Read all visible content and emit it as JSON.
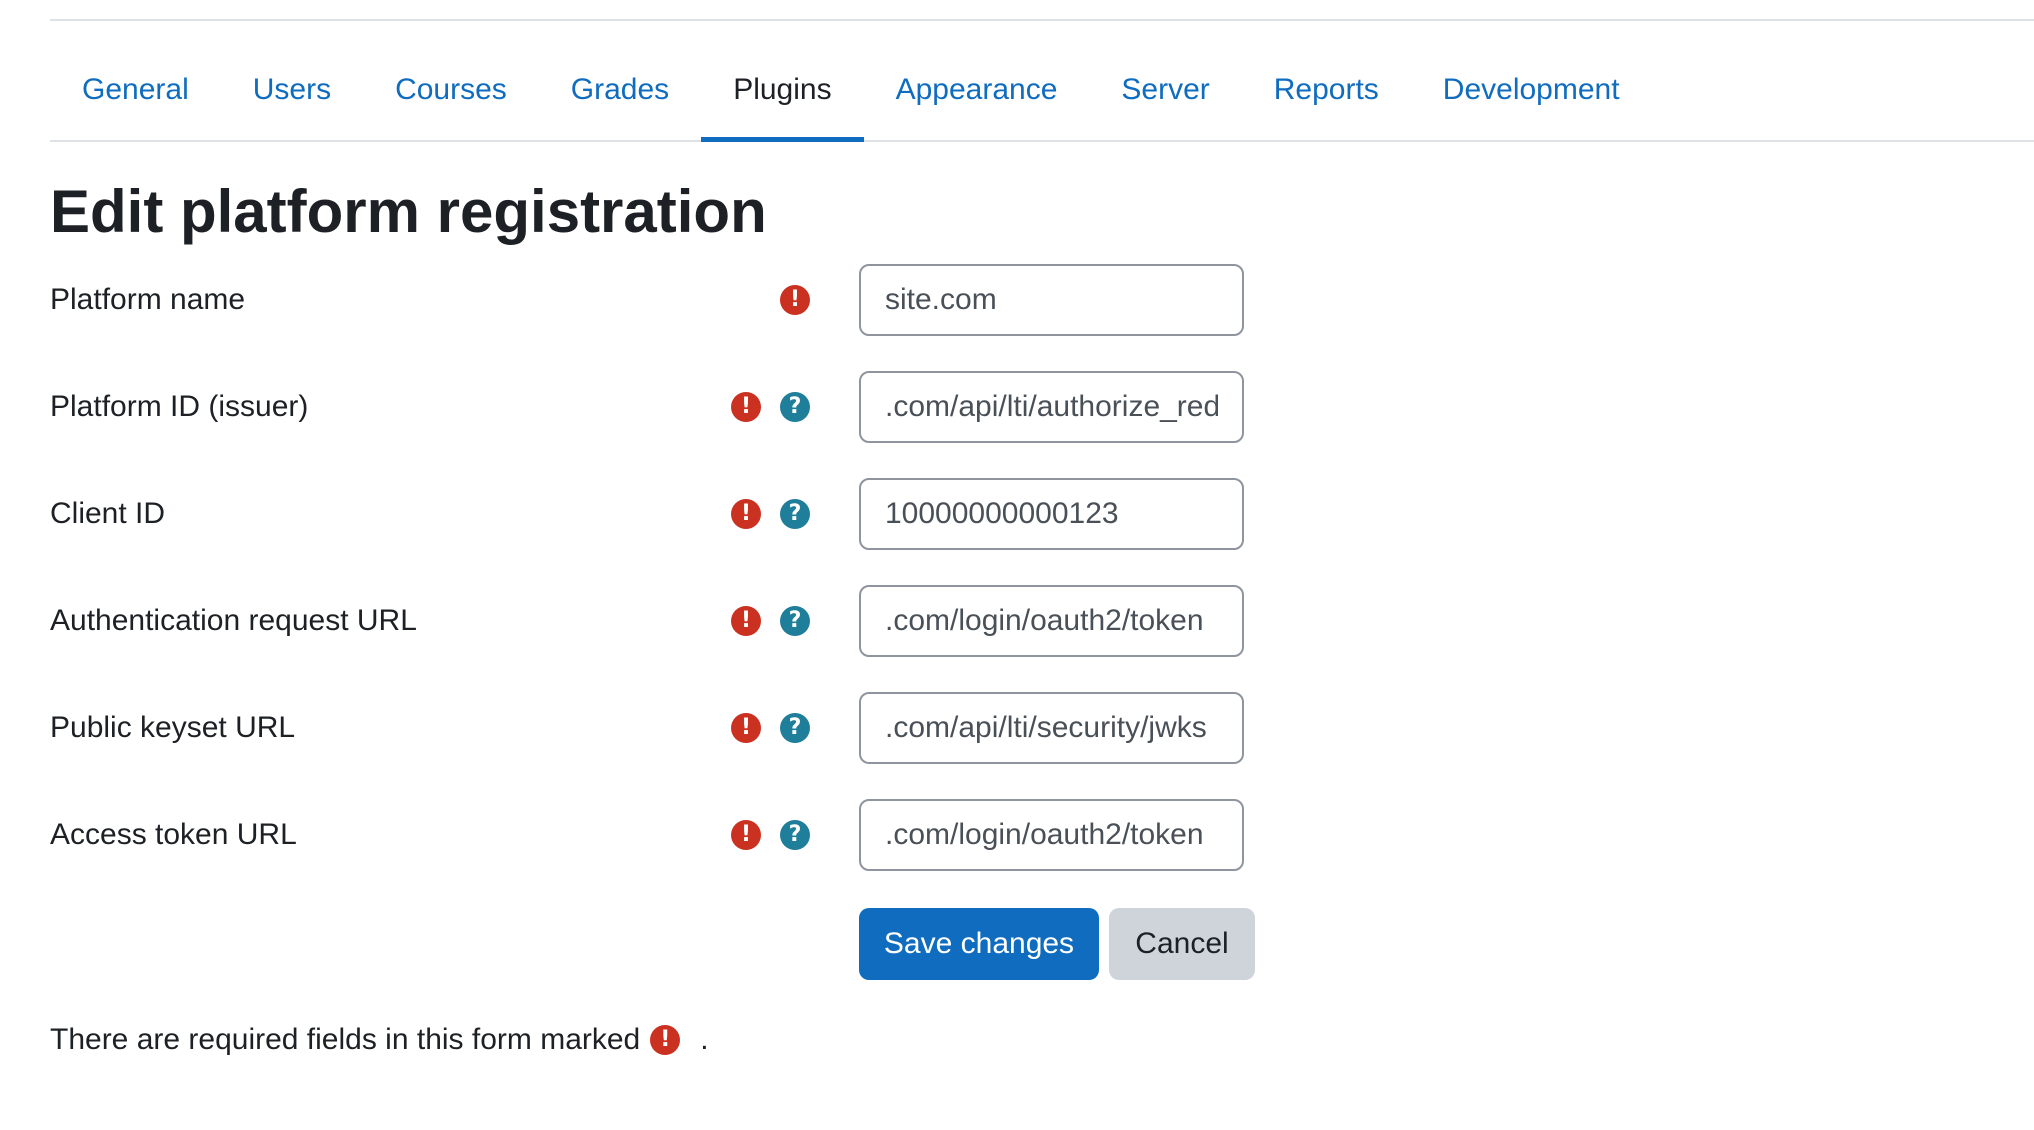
{
  "nav": {
    "tabs": [
      {
        "label": "General"
      },
      {
        "label": "Users"
      },
      {
        "label": "Courses"
      },
      {
        "label": "Grades"
      },
      {
        "label": "Plugins",
        "active": true
      },
      {
        "label": "Appearance"
      },
      {
        "label": "Server"
      },
      {
        "label": "Reports"
      },
      {
        "label": "Development"
      }
    ]
  },
  "page": {
    "title": "Edit platform registration"
  },
  "form": {
    "fields": [
      {
        "label": "Platform name",
        "value": "site.com",
        "required": true,
        "help": false
      },
      {
        "label": "Platform ID (issuer)",
        "value": ".com/api/lti/authorize_redirect",
        "required": true,
        "help": true
      },
      {
        "label": "Client ID",
        "value": "10000000000123",
        "required": true,
        "help": true
      },
      {
        "label": "Authentication request URL",
        "value": ".com/login/oauth2/token",
        "required": true,
        "help": true
      },
      {
        "label": "Public keyset URL",
        "value": ".com/api/lti/security/jwks",
        "required": true,
        "help": true
      },
      {
        "label": "Access token URL",
        "value": ".com/login/oauth2/token",
        "required": true,
        "help": true
      }
    ],
    "save_label": "Save changes",
    "cancel_label": "Cancel",
    "required_note": "There are required fields in this form marked",
    "required_note_end": "."
  },
  "icons": {
    "required": "exclamation-circle-icon",
    "help": "question-circle-icon"
  },
  "colors": {
    "link": "#0f6cbf",
    "primary": "#0f6cbf",
    "required": "#ca3120",
    "help": "#1f7e9a",
    "secondary": "#ced4da"
  }
}
